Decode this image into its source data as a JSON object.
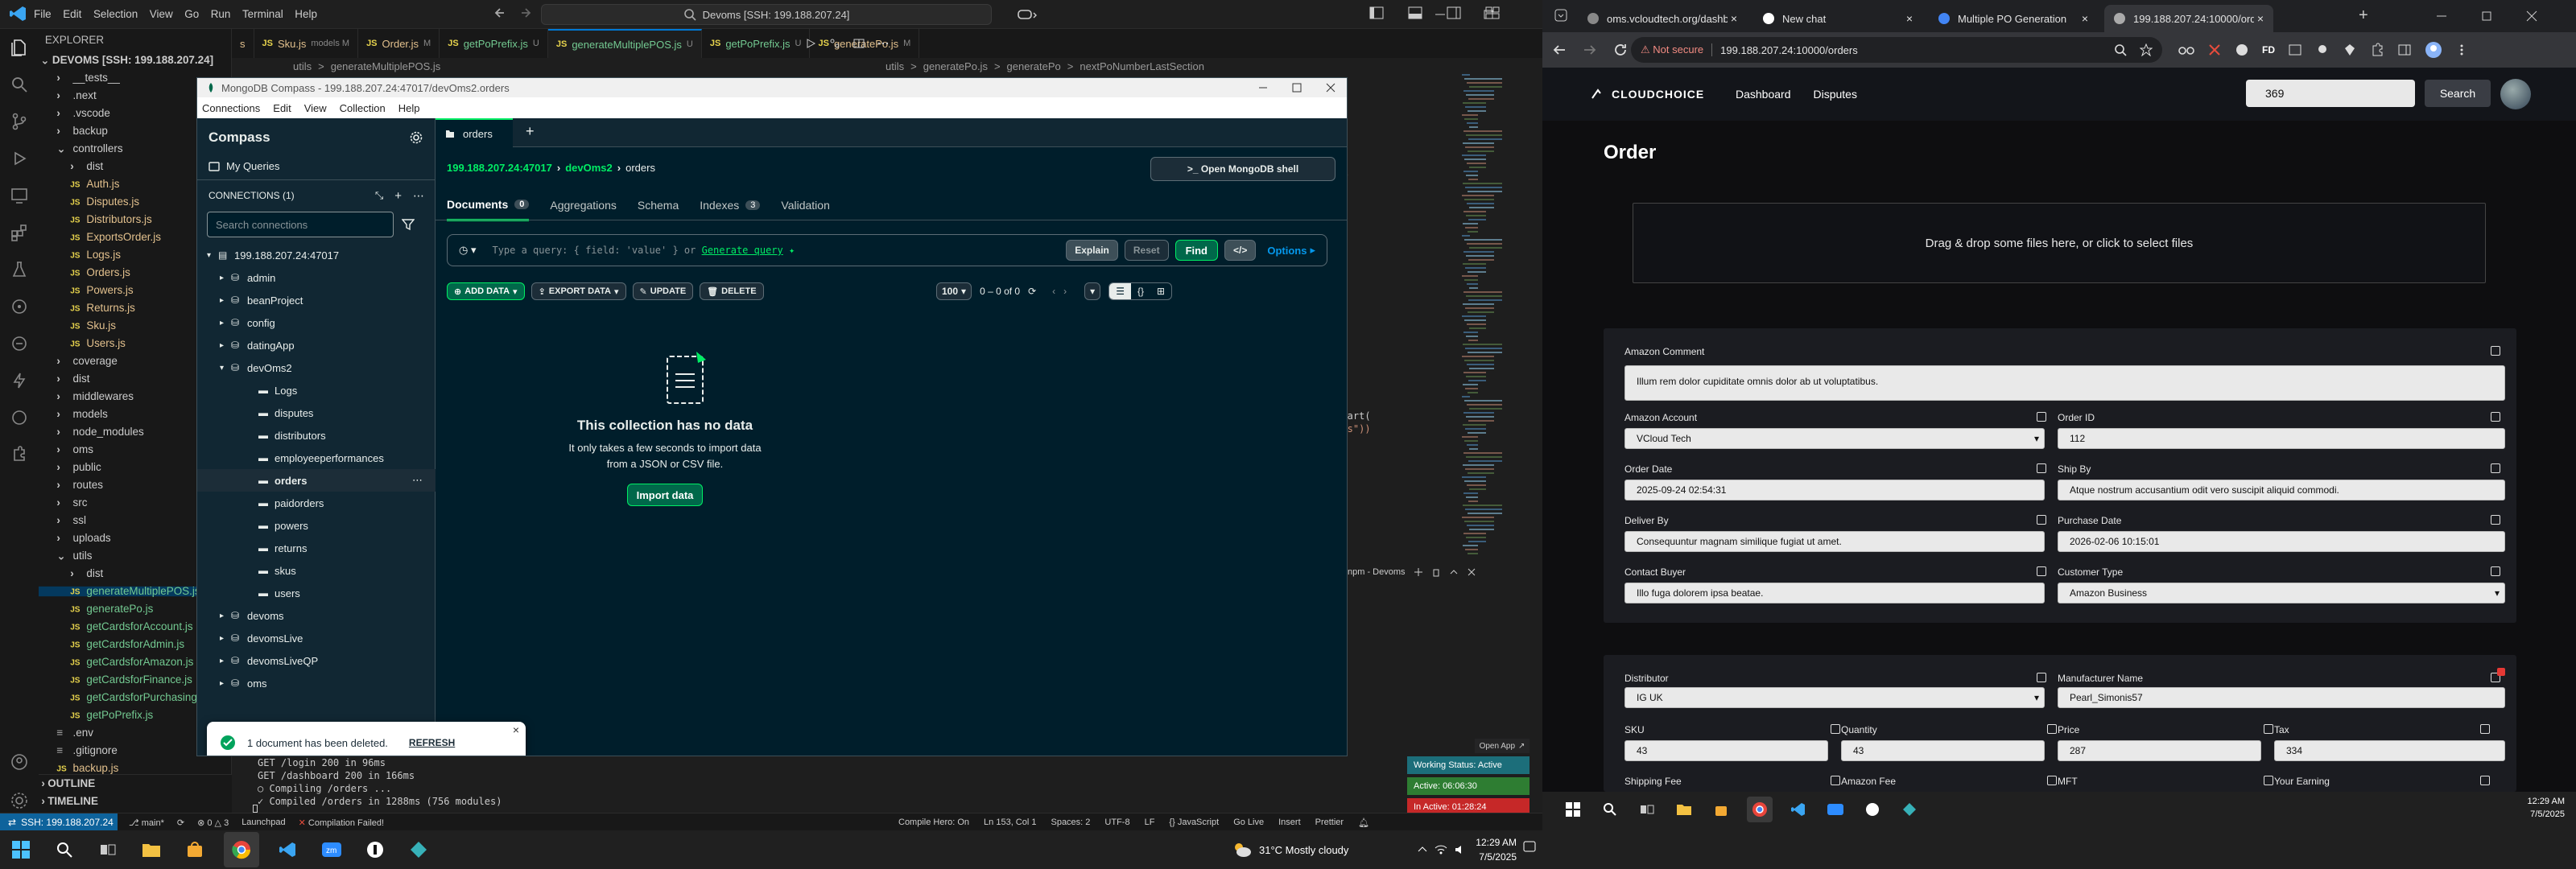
{
  "vscode": {
    "menu": [
      "File",
      "Edit",
      "Selection",
      "View",
      "Go",
      "Run",
      "Terminal",
      "Help"
    ],
    "search": "Devoms [SSH: 199.188.207.24]",
    "explorer_title": "EXPLORER",
    "workspace": "DEVOMS [SSH: 199.188.207.24]",
    "tree": [
      {
        "label": "__tests__",
        "indent": 1,
        "type": "folder"
      },
      {
        "label": ".next",
        "indent": 1,
        "type": "folder"
      },
      {
        "label": ".vscode",
        "indent": 1,
        "type": "folder"
      },
      {
        "label": "backup",
        "indent": 1,
        "type": "folder"
      },
      {
        "label": "controllers",
        "indent": 1,
        "type": "folder-open"
      },
      {
        "label": "dist",
        "indent": 2,
        "type": "folder"
      },
      {
        "label": "Auth.js",
        "indent": 2,
        "type": "js"
      },
      {
        "label": "Disputes.js",
        "indent": 2,
        "type": "js"
      },
      {
        "label": "Distributors.js",
        "indent": 2,
        "type": "js"
      },
      {
        "label": "ExportsOrder.js",
        "indent": 2,
        "type": "js"
      },
      {
        "label": "Logs.js",
        "indent": 2,
        "type": "js"
      },
      {
        "label": "Orders.js",
        "indent": 2,
        "type": "js"
      },
      {
        "label": "Powers.js",
        "indent": 2,
        "type": "js"
      },
      {
        "label": "Returns.js",
        "indent": 2,
        "type": "js"
      },
      {
        "label": "Sku.js",
        "indent": 2,
        "type": "js"
      },
      {
        "label": "Users.js",
        "indent": 2,
        "type": "js"
      },
      {
        "label": "coverage",
        "indent": 1,
        "type": "folder"
      },
      {
        "label": "dist",
        "indent": 1,
        "type": "folder"
      },
      {
        "label": "middlewares",
        "indent": 1,
        "type": "folder"
      },
      {
        "label": "models",
        "indent": 1,
        "type": "folder"
      },
      {
        "label": "node_modules",
        "indent": 1,
        "type": "folder"
      },
      {
        "label": "oms",
        "indent": 1,
        "type": "folder"
      },
      {
        "label": "public",
        "indent": 1,
        "type": "folder"
      },
      {
        "label": "routes",
        "indent": 1,
        "type": "folder"
      },
      {
        "label": "src",
        "indent": 1,
        "type": "folder"
      },
      {
        "label": "ssl",
        "indent": 1,
        "type": "folder"
      },
      {
        "label": "uploads",
        "indent": 1,
        "type": "folder"
      },
      {
        "label": "utils",
        "indent": 1,
        "type": "folder-open"
      },
      {
        "label": "dist",
        "indent": 2,
        "type": "folder"
      },
      {
        "label": "generateMultiplePOS.js",
        "indent": 2,
        "type": "js"
      },
      {
        "label": "generatePo.js",
        "indent": 2,
        "type": "js"
      },
      {
        "label": "getCardsforAccount.js",
        "indent": 2,
        "type": "js"
      },
      {
        "label": "getCardsforAdmin.js",
        "indent": 2,
        "type": "js"
      },
      {
        "label": "getCardsforAmazon.js",
        "indent": 2,
        "type": "js"
      },
      {
        "label": "getCardsforFinance.js",
        "indent": 2,
        "type": "js"
      },
      {
        "label": "getCardsforPurchasing.js",
        "indent": 2,
        "type": "js"
      },
      {
        "label": "getPoPrefix.js",
        "indent": 2,
        "type": "js"
      },
      {
        "label": ".env",
        "indent": 1,
        "type": "file"
      },
      {
        "label": ".gitignore",
        "indent": 1,
        "type": "file"
      },
      {
        "label": "backup.js",
        "indent": 1,
        "type": "js"
      }
    ],
    "outline": "OUTLINE",
    "timeline": "TIMELINE",
    "tabs": [
      {
        "label": "s"
      },
      {
        "label": "Sku.js",
        "suffix": "models M"
      },
      {
        "label": "Order.js",
        "suffix": "M"
      },
      {
        "label": "getPoPrefix.js",
        "suffix": "U"
      },
      {
        "label": "generateMultiplePOS.js",
        "suffix": "U",
        "active": true
      },
      {
        "label": "getPoPrefix.js",
        "suffix": "U"
      },
      {
        "label": "generatePo.js",
        "suffix": "M"
      }
    ],
    "breadcrumb_left": [
      "utils",
      ">",
      "generateMultiplePOS.js"
    ],
    "breadcrumb_right": [
      "utils",
      ">",
      "generatePo.js",
      ">",
      "generatePo",
      ">",
      "nextPoNumberLastSection"
    ],
    "code_fragments": [
      ") ];",
      "dStart(",
      "rtis\"))",
      ");",
      "on)"
    ],
    "terminal": {
      "lines": [
        "GET /login 200 in 96ms",
        "GET /dashboard 200 in 166ms",
        "○ Compiling /orders ...",
        "✓ Compiled /orders in 1288ms (756 modules)"
      ],
      "panel_label": "npm - Devoms"
    },
    "working_status": {
      "status": "Working Status: Active",
      "active": "Active: 06:06:30",
      "inactive": "In Active: 01:28:24"
    },
    "open_app": "Open App",
    "statusbar": {
      "ssh": "SSH: 199.188.207.24",
      "branch": "main*",
      "errors": "0",
      "warnings": "3",
      "launchpad": "Launchpad",
      "compile": "Compilation Failed!",
      "compile_hero": "Compile Hero: On",
      "position": "Ln 153, Col 1",
      "spaces": "Spaces: 2",
      "encoding": "UTF-8",
      "eol": "LF",
      "lang": "{} JavaScript",
      "golive": "Go Live",
      "insert": "Insert",
      "prettier": "Prettier"
    },
    "taskbar": {
      "weather": "31°C Mostly cloudy",
      "time": "12:29 AM",
      "date": "7/5/2025"
    }
  },
  "compass": {
    "title": "MongoDB Compass - 199.188.207.24:47017/devOms2.orders",
    "menu": [
      "Connections",
      "Edit",
      "View",
      "Collection",
      "Help"
    ],
    "brand": "Compass",
    "my_queries": "My Queries",
    "connections_label": "CONNECTIONS (1)",
    "search_placeholder": "Search connections",
    "connection": "199.188.207.24:47017",
    "databases": [
      "admin",
      "beanProject",
      "config",
      "datingApp",
      "devOms2"
    ],
    "collections": [
      "Logs",
      "disputes",
      "distributors",
      "employeeperformances",
      "orders",
      "paidorders",
      "powers",
      "returns",
      "skus",
      "users"
    ],
    "databases_after": [
      "devoms",
      "devomsLive",
      "devomsLiveQP"
    ],
    "bottom_db": "oms",
    "tab": "orders",
    "breadcrumb": [
      "199.188.207.24:47017",
      "devOms2",
      "orders"
    ],
    "shell_button": ">_ Open MongoDB shell",
    "subtabs": [
      {
        "label": "Documents",
        "count": "0",
        "active": true
      },
      {
        "label": "Aggregations"
      },
      {
        "label": "Schema"
      },
      {
        "label": "Indexes",
        "count": "3"
      },
      {
        "label": "Validation"
      }
    ],
    "query_placeholder": "Type a query: { field: 'value' } or",
    "generate_query": "Generate query",
    "explain": "Explain",
    "reset": "Reset",
    "find": "Find",
    "options": "Options",
    "add_data": "ADD DATA",
    "export_data": "EXPORT DATA",
    "update": "UPDATE",
    "delete": "DELETE",
    "page_size": "100",
    "range": "0 – 0 of 0",
    "empty_title": "This collection has no data",
    "empty_text": "It only takes a few seconds to import data from a JSON or CSV file.",
    "import_button": "Import data",
    "toast": {
      "text": "1 document has been deleted.",
      "action": "REFRESH"
    },
    "accent": "#00ed64"
  },
  "chrome": {
    "tabs": [
      {
        "label": "oms.vcloudtech.org/dashboard"
      },
      {
        "label": "New chat"
      },
      {
        "label": "Multiple PO Generation"
      },
      {
        "label": "199.188.207.24:10000/orders",
        "active": true
      }
    ],
    "not_secure": "Not secure",
    "url": "199.188.207.24:10000/orders",
    "nav": {
      "logo": "CLOUDCHOICE",
      "links": [
        "Dashboard",
        "Disputes"
      ],
      "search_value": "369",
      "search_button": "Search"
    },
    "page_title": "Order",
    "dropzone": "Drag & drop some files here, or click to select files",
    "card1": {
      "comment_label": "Amazon Comment",
      "comment_value": "Illum rem dolor cupiditate omnis dolor ab ut voluptatibus.",
      "fields": [
        {
          "label": "Amazon Account",
          "value": "VCloud Tech",
          "select": true
        },
        {
          "label": "Order ID",
          "value": "112"
        },
        {
          "label": "Order Date",
          "value": "2025-09-24 02:54:31"
        },
        {
          "label": "Ship By",
          "value": "Atque nostrum accusantium odit vero suscipit aliquid commodi."
        },
        {
          "label": "Deliver By",
          "value": "Consequuntur magnam similique fugiat ut amet."
        },
        {
          "label": "Purchase Date",
          "value": "2026-02-06 10:15:01"
        },
        {
          "label": "Contact Buyer",
          "value": "Illo fuga dolorem ipsa beatae."
        },
        {
          "label": "Customer Type",
          "value": "Amazon Business",
          "select": true
        }
      ]
    },
    "card2": {
      "distributor_label": "Distributor",
      "distributor_value": "IG UK",
      "manufacturer_label": "Manufacturer Name",
      "manufacturer_value": "Pearl_Simonis57",
      "small": [
        {
          "label": "SKU",
          "value": "43"
        },
        {
          "label": "Quantity",
          "value": "43"
        },
        {
          "label": "Price",
          "value": "287"
        },
        {
          "label": "Tax",
          "value": "334"
        }
      ],
      "bottom_labels": [
        "Shipping Fee",
        "Amazon Fee",
        "MFT",
        "Your Earning"
      ]
    },
    "taskbar": {
      "time": "12:29 AM",
      "date": "7/5/2025"
    }
  }
}
